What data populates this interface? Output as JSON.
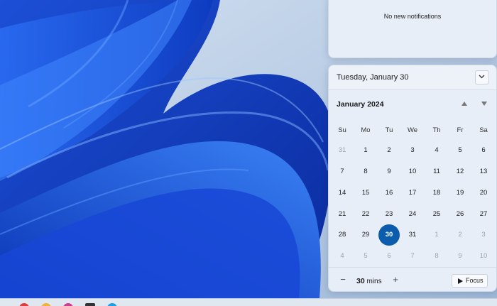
{
  "notifications": {
    "message": "No new notifications"
  },
  "calendar": {
    "selected_date": "Tuesday, January 30",
    "month_label": "January 2024",
    "weekdays": [
      "Su",
      "Mo",
      "Tu",
      "We",
      "Th",
      "Fr",
      "Sa"
    ],
    "weeks": [
      [
        {
          "d": "31",
          "faded": true
        },
        {
          "d": "1"
        },
        {
          "d": "2"
        },
        {
          "d": "3"
        },
        {
          "d": "4"
        },
        {
          "d": "5"
        },
        {
          "d": "6"
        }
      ],
      [
        {
          "d": "7"
        },
        {
          "d": "8"
        },
        {
          "d": "9"
        },
        {
          "d": "10"
        },
        {
          "d": "11"
        },
        {
          "d": "12"
        },
        {
          "d": "13"
        }
      ],
      [
        {
          "d": "14"
        },
        {
          "d": "15"
        },
        {
          "d": "16"
        },
        {
          "d": "17"
        },
        {
          "d": "18"
        },
        {
          "d": "19"
        },
        {
          "d": "20"
        }
      ],
      [
        {
          "d": "21"
        },
        {
          "d": "22"
        },
        {
          "d": "23"
        },
        {
          "d": "24"
        },
        {
          "d": "25"
        },
        {
          "d": "26"
        },
        {
          "d": "27"
        }
      ],
      [
        {
          "d": "28"
        },
        {
          "d": "29"
        },
        {
          "d": "30",
          "today": true
        },
        {
          "d": "31"
        },
        {
          "d": "1",
          "faded": true
        },
        {
          "d": "2",
          "faded": true
        },
        {
          "d": "3",
          "faded": true
        }
      ],
      [
        {
          "d": "4",
          "faded": true
        },
        {
          "d": "5",
          "faded": true
        },
        {
          "d": "6",
          "faded": true
        },
        {
          "d": "7",
          "faded": true
        },
        {
          "d": "8",
          "faded": true
        },
        {
          "d": "9",
          "faded": true
        },
        {
          "d": "10",
          "faded": true
        }
      ]
    ]
  },
  "focus": {
    "minus": "−",
    "plus": "+",
    "duration_value": "30",
    "duration_unit": "mins",
    "button_label": "Focus"
  },
  "colors": {
    "accent": "#0b5cad",
    "panel_bg": "#e7eef8"
  }
}
